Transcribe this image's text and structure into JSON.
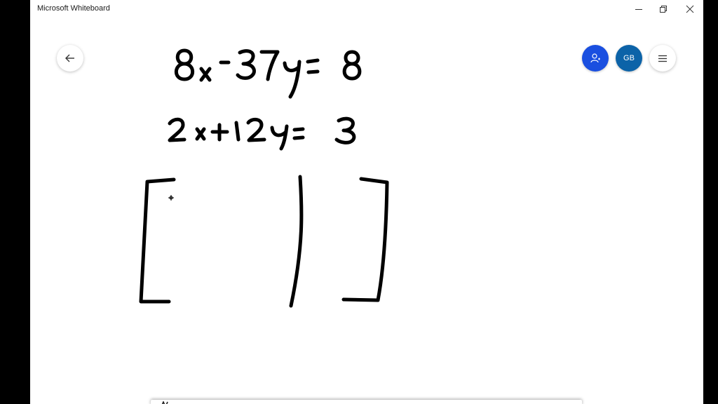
{
  "window": {
    "title": "Microsoft Whiteboard"
  },
  "header": {
    "account_initials": "GB"
  },
  "icons": {
    "back": "arrow-left-icon",
    "invite": "person-add-icon",
    "menu": "hamburger-menu-icon",
    "minimize": "minimize-icon",
    "restore": "restore-icon",
    "close": "close-icon"
  },
  "colors": {
    "invite_button": "#1a4fe0",
    "account_avatar": "#0c63a8",
    "ink": "#000000",
    "canvas": "#ffffff"
  }
}
